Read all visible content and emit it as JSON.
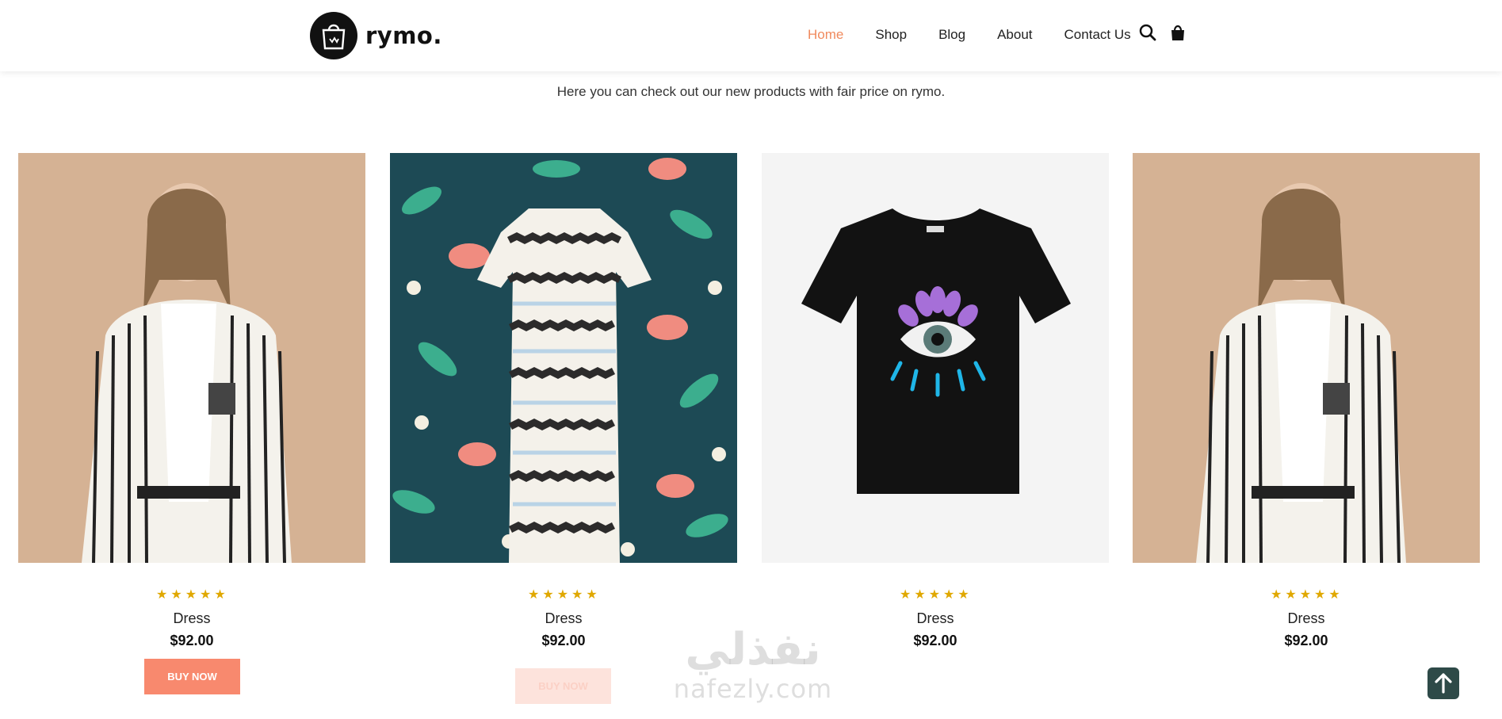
{
  "brand": {
    "name": "rymo."
  },
  "nav": {
    "items": [
      "Home",
      "Shop",
      "Blog",
      "About",
      "Contact Us"
    ],
    "active": "Home",
    "accent_color": "#f08a5d"
  },
  "icons": {
    "search": "search-icon",
    "cart": "shopping-bag-icon",
    "scroll_top": "arrow-up-icon"
  },
  "intro": {
    "text": "Here you can check out our new products with fair price on rymo."
  },
  "products": [
    {
      "name": "Dress",
      "price": "$92.00",
      "rating": 5,
      "image": "striped-blazer-model",
      "button": "BUY NOW"
    },
    {
      "name": "Dress",
      "price": "$92.00",
      "rating": 5,
      "image": "striped-knit-dress-floral",
      "button": "BUY NOW"
    },
    {
      "name": "Dress",
      "price": "$92.00",
      "rating": 5,
      "image": "black-tshirt-eye-print"
    },
    {
      "name": "Dress",
      "price": "$92.00",
      "rating": 5,
      "image": "striped-blazer-model"
    }
  ],
  "watermark": {
    "arabic": "نفذلي",
    "latin": "nafezly.com"
  },
  "colors": {
    "button": "#f8896e",
    "star": "#e0a800",
    "scroll_top_bg": "#2e4a48"
  }
}
